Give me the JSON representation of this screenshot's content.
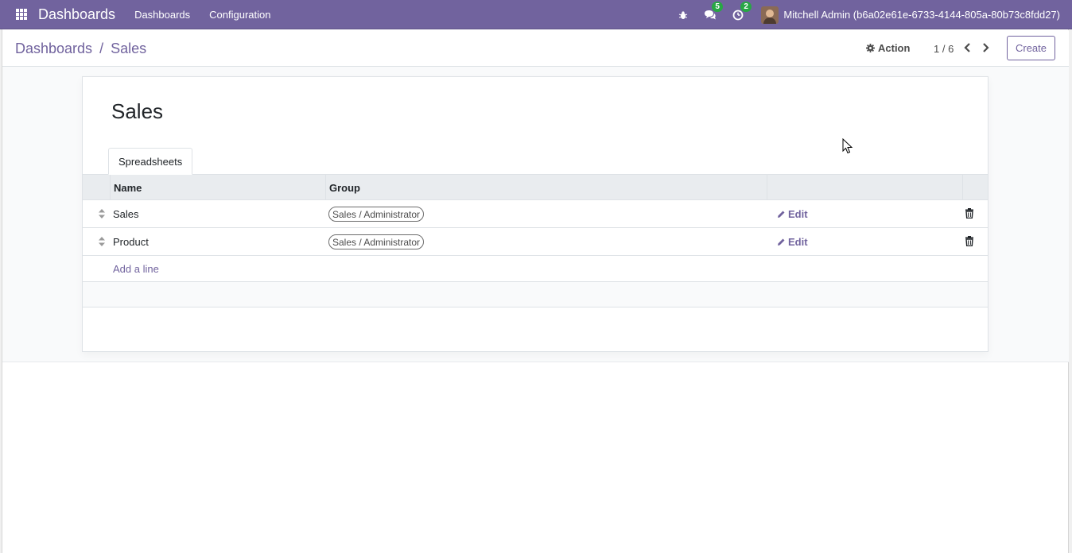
{
  "navbar": {
    "brand": "Dashboards",
    "menu": [
      "Dashboards",
      "Configuration"
    ],
    "messages_count": "5",
    "activities_count": "2",
    "user": "Mitchell Admin (b6a02e61e-6733-4144-805a-80b73c8fdd27)"
  },
  "control_panel": {
    "breadcrumb_parent": "Dashboards",
    "breadcrumb_separator": "/",
    "breadcrumb_current": "Sales",
    "action_label": "Action",
    "pager": "1 / 6",
    "create_label": "Create"
  },
  "form": {
    "title": "Sales",
    "tab_label": "Spreadsheets",
    "columns": [
      "Name",
      "Group"
    ],
    "rows": [
      {
        "name": "Sales",
        "group": "Sales / Administrator",
        "edit": "Edit"
      },
      {
        "name": "Product",
        "group": "Sales / Administrator",
        "edit": "Edit"
      }
    ],
    "add_line": "Add a line"
  },
  "colors": {
    "brand": "#71639e",
    "badge": "#28a745"
  }
}
